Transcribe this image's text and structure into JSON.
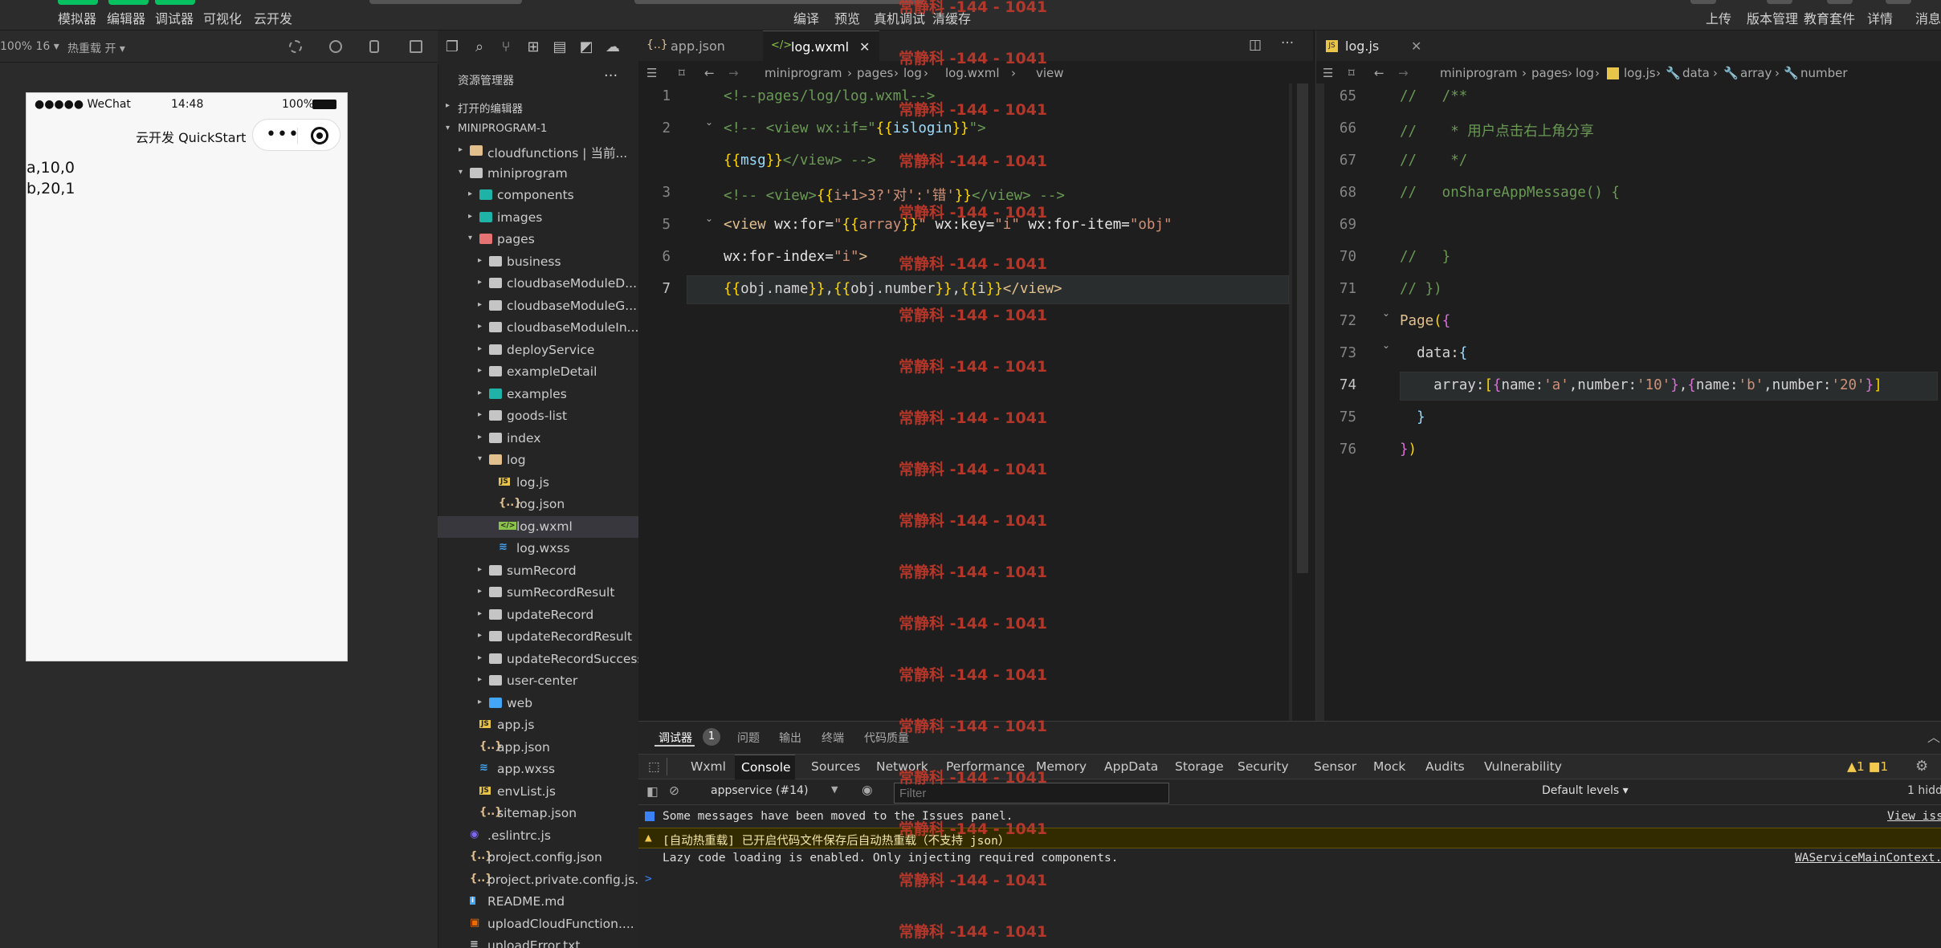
{
  "toolbar": {
    "left_items": [
      "模拟器",
      "编辑器",
      "调试器",
      "可视化",
      "云开发"
    ],
    "center_items": [
      "编译",
      "预览",
      "真机调试",
      "清缓存"
    ],
    "right_items": [
      "上传",
      "版本管理",
      "教育套件",
      "详情",
      "消息"
    ]
  },
  "simulator": {
    "zoom": "100% 16 ▾",
    "hot_reload": "热重载 开 ▾",
    "status": {
      "carrier": "●●●●● WeChat",
      "time": "14:48",
      "battery": "100%"
    },
    "nav_title": "云开发 QuickStart",
    "capsule_dots": "•••",
    "content_lines": [
      "a,10,0",
      "b,20,1"
    ]
  },
  "explorer": {
    "title": "资源管理器",
    "more": "···",
    "sections": [
      "打开的编辑器",
      "MINIPROGRAM-1"
    ],
    "tree": [
      {
        "label": "cloudfunctions | 当前...",
        "depth": 1,
        "type": "folder-cloud",
        "arrow": "▸"
      },
      {
        "label": "miniprogram",
        "depth": 1,
        "type": "folder-open",
        "arrow": "▾"
      },
      {
        "label": "components",
        "depth": 2,
        "type": "folder-teal",
        "arrow": "▸"
      },
      {
        "label": "images",
        "depth": 2,
        "type": "folder-teal",
        "arrow": "▸"
      },
      {
        "label": "pages",
        "depth": 2,
        "type": "folder-red",
        "arrow": "▾"
      },
      {
        "label": "business",
        "depth": 3,
        "type": "folder",
        "arrow": "▸"
      },
      {
        "label": "cloudbaseModuleD...",
        "depth": 3,
        "type": "folder",
        "arrow": "▸"
      },
      {
        "label": "cloudbaseModuleG...",
        "depth": 3,
        "type": "folder",
        "arrow": "▸"
      },
      {
        "label": "cloudbaseModuleIn...",
        "depth": 3,
        "type": "folder",
        "arrow": "▸"
      },
      {
        "label": "deployService",
        "depth": 3,
        "type": "folder",
        "arrow": "▸"
      },
      {
        "label": "exampleDetail",
        "depth": 3,
        "type": "folder",
        "arrow": "▸"
      },
      {
        "label": "examples",
        "depth": 3,
        "type": "folder-teal",
        "arrow": "▸"
      },
      {
        "label": "goods-list",
        "depth": 3,
        "type": "folder",
        "arrow": "▸"
      },
      {
        "label": "index",
        "depth": 3,
        "type": "folder",
        "arrow": "▸"
      },
      {
        "label": "log",
        "depth": 3,
        "type": "folder-yellow",
        "arrow": "▾"
      },
      {
        "label": "log.js",
        "depth": 4,
        "type": "js",
        "arrow": ""
      },
      {
        "label": "log.json",
        "depth": 4,
        "type": "json",
        "arrow": ""
      },
      {
        "label": "log.wxml",
        "depth": 4,
        "type": "wxml",
        "arrow": "",
        "selected": true
      },
      {
        "label": "log.wxss",
        "depth": 4,
        "type": "wxss",
        "arrow": ""
      },
      {
        "label": "sumRecord",
        "depth": 3,
        "type": "folder",
        "arrow": "▸"
      },
      {
        "label": "sumRecordResult",
        "depth": 3,
        "type": "folder",
        "arrow": "▸"
      },
      {
        "label": "updateRecord",
        "depth": 3,
        "type": "folder",
        "arrow": "▸"
      },
      {
        "label": "updateRecordResult",
        "depth": 3,
        "type": "folder",
        "arrow": "▸"
      },
      {
        "label": "updateRecordSuccess",
        "depth": 3,
        "type": "folder",
        "arrow": "▸"
      },
      {
        "label": "user-center",
        "depth": 3,
        "type": "folder",
        "arrow": "▸"
      },
      {
        "label": "web",
        "depth": 3,
        "type": "folder-blue",
        "arrow": "▸"
      },
      {
        "label": "app.js",
        "depth": 2,
        "type": "js",
        "arrow": ""
      },
      {
        "label": "app.json",
        "depth": 2,
        "type": "json",
        "arrow": ""
      },
      {
        "label": "app.wxss",
        "depth": 2,
        "type": "wxss",
        "arrow": ""
      },
      {
        "label": "envList.js",
        "depth": 2,
        "type": "js",
        "arrow": ""
      },
      {
        "label": "sitemap.json",
        "depth": 2,
        "type": "json",
        "arrow": ""
      },
      {
        "label": ".eslintrc.js",
        "depth": 1,
        "type": "eslint",
        "arrow": ""
      },
      {
        "label": "project.config.json",
        "depth": 1,
        "type": "json",
        "arrow": ""
      },
      {
        "label": "project.private.config.js...",
        "depth": 1,
        "type": "json",
        "arrow": ""
      },
      {
        "label": "README.md",
        "depth": 1,
        "type": "info",
        "arrow": ""
      },
      {
        "label": "uploadCloudFunction....",
        "depth": 1,
        "type": "shell",
        "arrow": ""
      },
      {
        "label": "uploadError.txt",
        "depth": 1,
        "type": "txt",
        "arrow": ""
      }
    ]
  },
  "editor1": {
    "tabs": [
      {
        "icon": "{..}",
        "label": "app.json",
        "active": false
      },
      {
        "icon": "</>",
        "label": "log.wxml",
        "active": true,
        "close": "✕"
      }
    ],
    "more": "···",
    "breadcrumb": [
      "miniprogram",
      "pages",
      "log",
      "log.wxml",
      "view"
    ],
    "lines": [
      {
        "n": "1",
        "text": "<!--pages/log/log.wxml-->"
      },
      {
        "n": "2",
        "text": "<!-- <view wx:if=\"{{islogin}}\">"
      },
      {
        "n": "",
        "text": "{{msg}}</view> -->"
      },
      {
        "n": "3",
        "text": "<!-- <view>{{i+1>3?'对':'错'}}</view> -->"
      },
      {
        "n": "5",
        "text": "<view wx:for=\"{{array}}\" wx:key=\"i\" wx:for-item=\"obj\""
      },
      {
        "n": "6",
        "text": "wx:for-index=\"i\">"
      },
      {
        "n": "7",
        "text": "{{obj.name}},{{obj.number}},{{i}}</view>"
      }
    ]
  },
  "editor2": {
    "tab": {
      "icon": "JS",
      "label": "log.js",
      "close": "✕"
    },
    "breadcrumb": [
      "miniprogram",
      "pages",
      "log",
      "log.js",
      "data",
      "array",
      "number"
    ],
    "lines": [
      {
        "n": "65",
        "text": "//   /**"
      },
      {
        "n": "66",
        "text": "//    * 用户点击右上角分享"
      },
      {
        "n": "67",
        "text": "//    */"
      },
      {
        "n": "68",
        "text": "//   onShareAppMessage() {"
      },
      {
        "n": "69",
        "text": ""
      },
      {
        "n": "70",
        "text": "//   }"
      },
      {
        "n": "71",
        "text": "// })"
      },
      {
        "n": "72",
        "text": "Page({"
      },
      {
        "n": "73",
        "text": "  data:{"
      },
      {
        "n": "74",
        "text": "    array:[{name:'a',number:'10'},{name:'b',number:'20'}]"
      },
      {
        "n": "75",
        "text": "  }"
      },
      {
        "n": "76",
        "text": "})"
      }
    ]
  },
  "watermark": "常静科 -144 - 1041",
  "devtools": {
    "top_tabs": [
      "调试器",
      "1",
      "问题",
      "输出",
      "终端",
      "代码质量"
    ],
    "panel_tabs": [
      "Wxml",
      "Console",
      "Sources",
      "Network",
      "Performance",
      "Memory",
      "AppData",
      "Storage",
      "Security",
      "Sensor",
      "Mock",
      "Audits",
      "Vulnerability"
    ],
    "active_panel": "Console",
    "counts": "▲1 ■1",
    "context": "appservice (#14)",
    "filter_placeholder": "Filter",
    "levels": "Default levels ▾",
    "hidden": "1 hidd",
    "messages": [
      {
        "type": "info",
        "text": "Some messages have been moved to the Issues panel.",
        "link": "View iss"
      },
      {
        "type": "warn",
        "text": "[自动热重载] 已开启代码文件保存后自动热重载（不支持 json）",
        "link": ""
      },
      {
        "type": "log",
        "text": "Lazy code loading is enabled. Only injecting required components.",
        "link": "WAServiceMainContext.j"
      }
    ],
    "prompt": ">"
  },
  "colors": {
    "accent_green": "#07c160",
    "warn_bg": "#332b00",
    "watermark": "#c0392b"
  }
}
